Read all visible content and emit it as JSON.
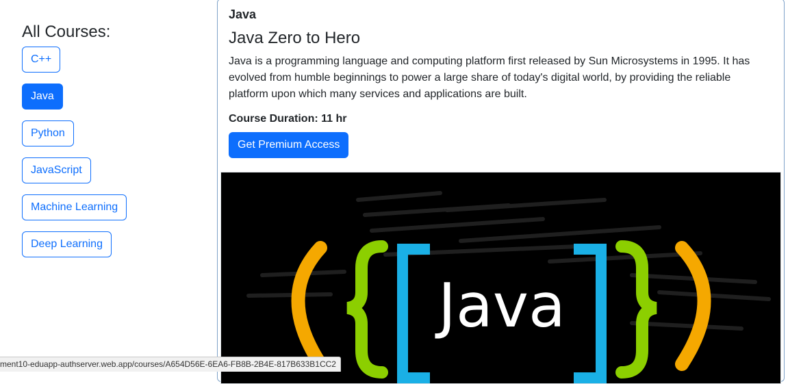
{
  "sidebar": {
    "heading": "All Courses:",
    "courses": [
      {
        "label": "C++",
        "active": false
      },
      {
        "label": "Java",
        "active": true
      },
      {
        "label": "Python",
        "active": false
      },
      {
        "label": "JavaScript",
        "active": false
      },
      {
        "label": "Machine Learning",
        "active": false
      },
      {
        "label": "Deep Learning",
        "active": false
      }
    ]
  },
  "course": {
    "category": "Java",
    "title": "Java Zero to Hero",
    "description": "Java is a programming language and computing platform first released by Sun Microsystems in 1995. It has evolved from humble beginnings to power a large share of today's digital world, by providing the reliable platform upon which many services and applications are built.",
    "duration": "Course Duration: 11 hr",
    "premium_button": "Get Premium Access",
    "image": {
      "logo_text": "Java",
      "colors": {
        "parens": "#f5a800",
        "braces": "#8ccf00",
        "brackets": "#1ab0e6",
        "background": "#000000"
      }
    }
  },
  "status_url": "ment10-eduapp-authserver.web.app/courses/A654D56E-6EA6-FB8B-2B4E-817B633B1CC2",
  "colors": {
    "primary": "#0d6efd",
    "text": "#212529"
  }
}
